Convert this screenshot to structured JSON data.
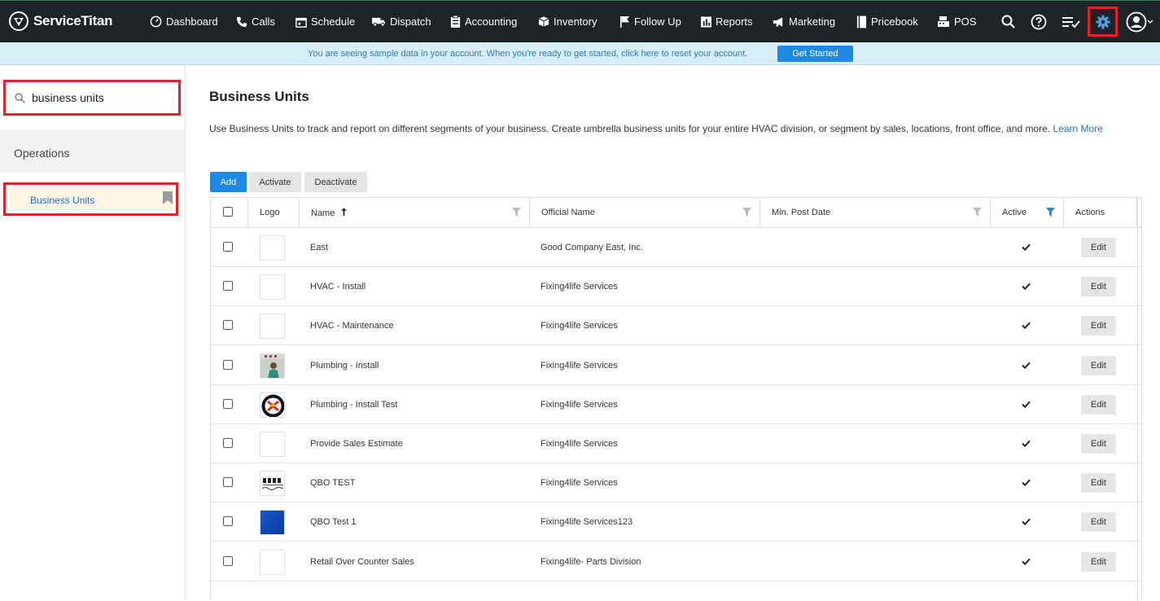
{
  "brand": {
    "name": "ServiceTitan"
  },
  "nav": [
    {
      "label": "Dashboard",
      "icon": "dashboard-icon"
    },
    {
      "label": "Calls",
      "icon": "phone-icon"
    },
    {
      "label": "Schedule",
      "icon": "calendar-icon"
    },
    {
      "label": "Dispatch",
      "icon": "truck-icon"
    },
    {
      "label": "Accounting",
      "icon": "clipboard-icon"
    },
    {
      "label": "Inventory",
      "icon": "box-icon"
    },
    {
      "label": "Follow Up",
      "icon": "flag-icon"
    },
    {
      "label": "Reports",
      "icon": "bar-chart-icon"
    },
    {
      "label": "Marketing",
      "icon": "megaphone-icon"
    },
    {
      "label": "Pricebook",
      "icon": "book-icon"
    },
    {
      "label": "POS",
      "icon": "register-icon"
    }
  ],
  "banner": {
    "text": "You are seeing sample data in your account. When you're ready to get started, click here to reset your account.",
    "button": "Get Started"
  },
  "sidebar": {
    "search_value": "business units",
    "section": "Operations",
    "item": "Business Units"
  },
  "main": {
    "title": "Business Units",
    "description": "Use Business Units to track and report on different segments of your business. Create umbrella business units for your entire HVAC division, or segment by sales, locations, front office, and more.",
    "learn_more": "Learn More",
    "buttons": {
      "add": "Add",
      "activate": "Activate",
      "deactivate": "Deactivate"
    }
  },
  "table": {
    "columns": {
      "logo": "Logo",
      "name": "Name",
      "official_name": "Official Name",
      "min_post_date": "Min. Post Date",
      "active": "Active",
      "actions": "Actions"
    },
    "edit_label": "Edit",
    "rows": [
      {
        "name": "East",
        "official_name": "Good Company East, Inc.",
        "logo": "none",
        "active": true
      },
      {
        "name": "HVAC - Install",
        "official_name": "Fixing4life Services",
        "logo": "none",
        "active": true
      },
      {
        "name": "HVAC - Maintenance",
        "official_name": "Fixing4life Services",
        "logo": "none",
        "active": true
      },
      {
        "name": "Plumbing - Install",
        "official_name": "Fixing4life Services",
        "logo": "photo",
        "active": true
      },
      {
        "name": "Plumbing - Install Test",
        "official_name": "Fixing4life Services",
        "logo": "circle-emblem",
        "active": true
      },
      {
        "name": "Provide Sales Estimate",
        "official_name": "Fixing4life Services",
        "logo": "none",
        "active": true
      },
      {
        "name": "QBO TEST",
        "official_name": "Fixing4life Services",
        "logo": "text-logo",
        "active": true
      },
      {
        "name": "QBO Test 1",
        "official_name": "Fixing4life Services123",
        "logo": "blue-square",
        "active": true
      },
      {
        "name": "Retail Over Counter Sales",
        "official_name": "Fixing4life- Parts Division",
        "logo": "none",
        "active": true
      }
    ]
  },
  "colors": {
    "nav_bg": "#1f2327",
    "accent": "#1e88e5",
    "highlight": "#e32024",
    "banner_bg": "#d8eef9"
  }
}
